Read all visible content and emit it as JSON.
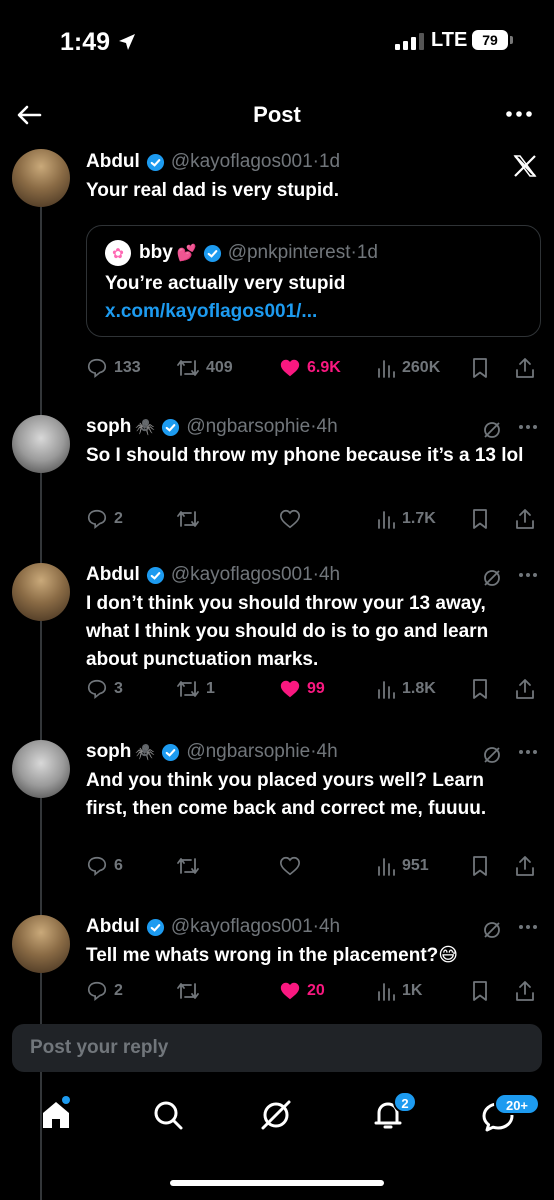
{
  "status_bar": {
    "time": "1:49",
    "network": "LTE",
    "battery": "79"
  },
  "header": {
    "title": "Post"
  },
  "tweets": [
    {
      "name": "Abdul",
      "handle": "@kayoflagos001",
      "time": "1d",
      "text": "Your real dad is very stupid.",
      "quote": {
        "name": "bby",
        "name_emoji": "💕",
        "handle": "@pnkpinterest",
        "time": "1d",
        "text": "You’re actually very stupid ",
        "link": "x.com/kayoflagos001/..."
      },
      "replies": "133",
      "reposts": "409",
      "likes": "6.9K",
      "views": "260K",
      "liked": true
    },
    {
      "name": "soph",
      "name_emoji": "🕷️",
      "handle": "@ngbarsophie",
      "time": "4h",
      "text": "So I should throw my phone because it’s a 13 lol",
      "replies": "2",
      "reposts": "",
      "likes": "",
      "views": "1.7K",
      "liked": false
    },
    {
      "name": "Abdul",
      "handle": "@kayoflagos001",
      "time": "4h",
      "text": "I don’t think you should throw your 13 away, what I think you should do is to go and learn about punctuation marks.",
      "replies": "3",
      "reposts": "1",
      "likes": "99",
      "views": "1.8K",
      "liked": true
    },
    {
      "name": "soph",
      "name_emoji": "🕷️",
      "handle": "@ngbarsophie",
      "time": "4h",
      "text": "And you think you placed yours well? Learn first, then come back and correct me, fuuuu.",
      "replies": "6",
      "reposts": "",
      "likes": "",
      "views": "951",
      "liked": false
    },
    {
      "name": "Abdul",
      "handle": "@kayoflagos001",
      "time": "4h",
      "text": "Tell me whats wrong in the placement?😅",
      "replies": "2",
      "reposts": "",
      "likes": "20",
      "views": "1K",
      "liked": true
    }
  ],
  "reply_bar": {
    "placeholder": "Post your reply"
  },
  "tabbar": {
    "notifications_badge": "2",
    "messages_badge": "20+"
  },
  "colors": {
    "accent": "#1d9bf0",
    "like": "#f91880",
    "muted": "#71767b",
    "background": "#000000"
  }
}
